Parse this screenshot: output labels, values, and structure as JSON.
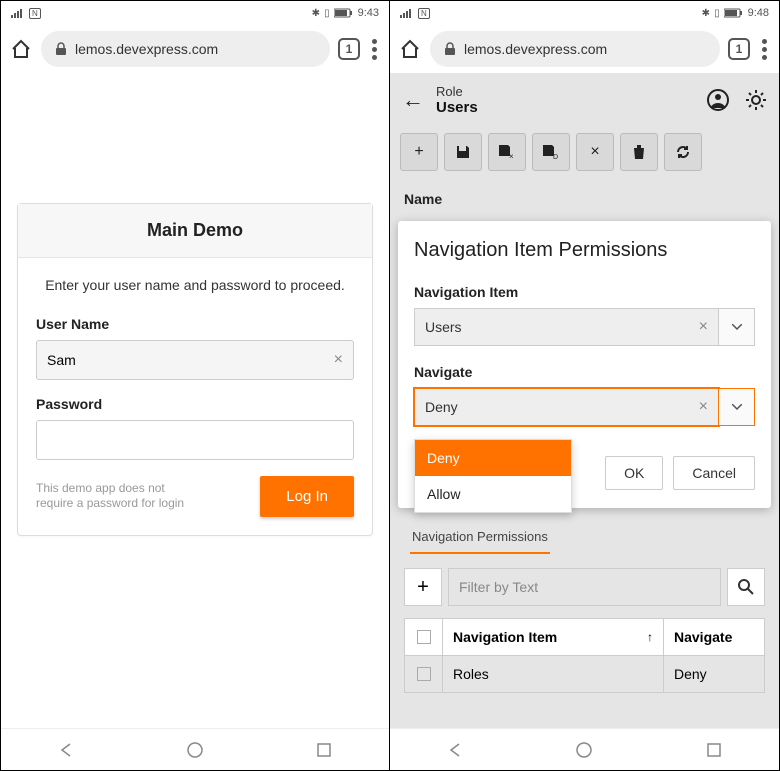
{
  "left": {
    "status": {
      "time": "9:43"
    },
    "browser": {
      "url": "lemos.devexpress.com",
      "tabs": "1"
    },
    "card": {
      "title": "Main Demo",
      "subtitle": "Enter your user name and password to proceed.",
      "user_label": "User Name",
      "user_value": "Sam",
      "pass_label": "Password",
      "hint": "This demo app does not require a password for login",
      "login_btn": "Log In"
    }
  },
  "right": {
    "status": {
      "time": "9:48"
    },
    "browser": {
      "url": "lemos.devexpress.com",
      "tabs": "1"
    },
    "header": {
      "crumb": "Role",
      "title": "Users"
    },
    "section_label": "Name",
    "modal": {
      "title": "Navigation Item Permissions",
      "nav_item_label": "Navigation Item",
      "nav_item_value": "Users",
      "navigate_label": "Navigate",
      "navigate_value": "Deny",
      "options": [
        "Deny",
        "Allow"
      ],
      "ok": "OK",
      "cancel": "Cancel"
    },
    "tab": "Navigation Permissions",
    "filter_placeholder": "Filter by Text",
    "grid": {
      "col1": "Navigation Item",
      "col2": "Navigate",
      "row1_item": "Roles",
      "row1_nav": "Deny"
    }
  }
}
